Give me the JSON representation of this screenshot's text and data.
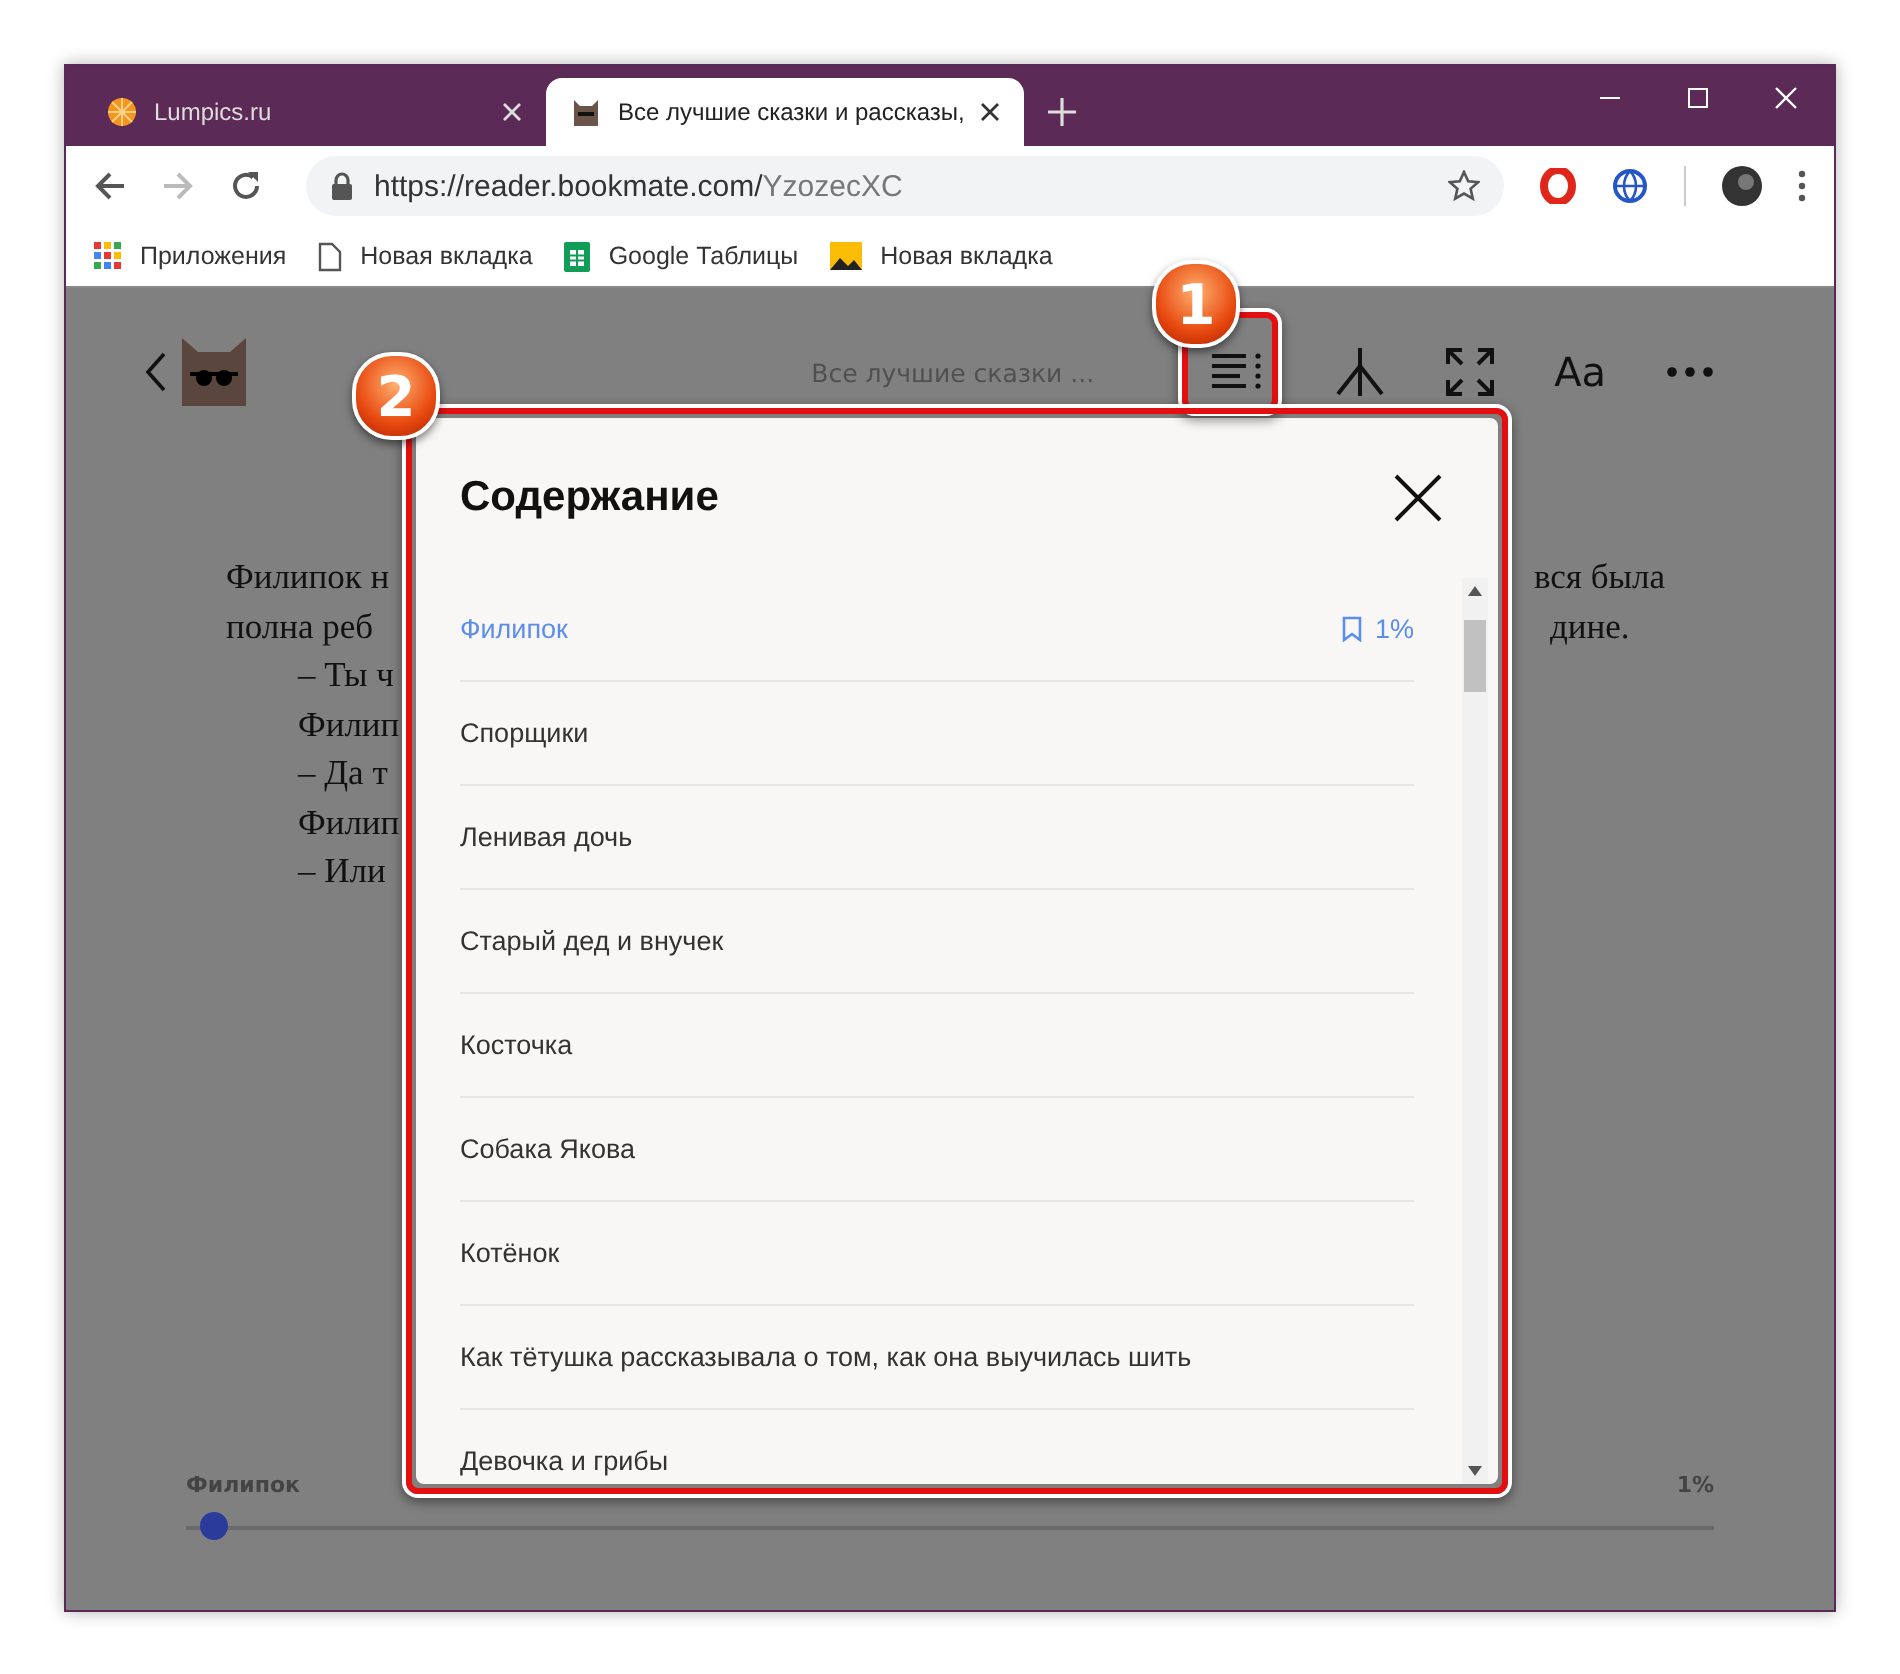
{
  "browser": {
    "tabs": [
      {
        "title": "Lumpics.ru",
        "selected": false
      },
      {
        "title": "Все лучшие сказки и рассказы,",
        "selected": true
      }
    ],
    "address": {
      "host": "https://reader.bookmate.com/",
      "path": "YzozecXC"
    },
    "bookmarks": [
      {
        "label": "Приложения"
      },
      {
        "label": "Новая вкладка"
      },
      {
        "label": "Google Таблицы"
      },
      {
        "label": "Новая вкладка"
      }
    ]
  },
  "reader": {
    "book_title": "Все лучшие сказки ...",
    "font_button": "Aa",
    "text_left": [
      "Филипок н",
      "полна реб",
      "– Ты ч",
      "Филип",
      "– Да т",
      "Филип",
      "– Или"
    ],
    "text_right": [
      "вся была",
      "дине."
    ],
    "toc": {
      "title": "Содержание",
      "items": [
        {
          "label": "Филипок",
          "selected": true,
          "percent": "1%"
        },
        {
          "label": "Спорщики",
          "selected": false
        },
        {
          "label": "Ленивая дочь",
          "selected": false
        },
        {
          "label": "Старый дед и внучек",
          "selected": false
        },
        {
          "label": "Косточка",
          "selected": false
        },
        {
          "label": "Собака Якова",
          "selected": false
        },
        {
          "label": "Котёнок",
          "selected": false
        },
        {
          "label": "Как тётушка рассказывала о том, как она выучилась шить",
          "selected": false
        },
        {
          "label": "Девочка и грибы",
          "selected": false
        }
      ]
    },
    "progress": {
      "chapter": "Филипок",
      "percent": "1%",
      "level": 0.01
    }
  },
  "annotations": [
    {
      "number": "1"
    },
    {
      "number": "2"
    }
  ]
}
